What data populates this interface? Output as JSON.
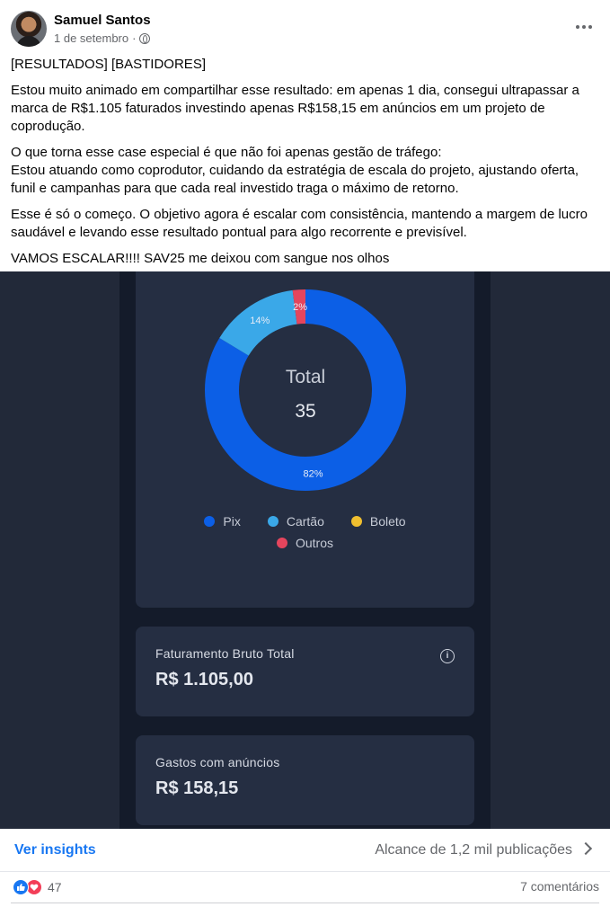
{
  "post": {
    "author": "Samuel Santos",
    "date": "1 de setembro",
    "separator": "·",
    "privacy_icon": "globe-icon",
    "more_icon": "more-horizontal-icon",
    "paragraphs": [
      "[RESULTADOS] [BASTIDORES]",
      "Estou muito animado em compartilhar esse resultado: em apenas 1 dia, consegui ultrapassar a marca de R$1.105 faturados investindo apenas R$158,15 em anúncios em um projeto de coprodução.",
      "O que torna esse case especial é que não foi apenas gestão de tráfego:\nEstou atuando como coprodutor, cuidando da estratégia de escala do projeto, ajustando oferta, funil e campanhas para que cada real investido traga o máximo de retorno.",
      "Esse é só o começo. O objetivo agora é escalar com consistência, mantendo a margem de lucro saudável e levando esse resultado pontual para algo recorrente e previsível.",
      "VAMOS ESCALAR!!!! SAV25 me deixou com sangue nos olhos"
    ]
  },
  "image": {
    "donut": {
      "center_title": "Total",
      "center_value": "35"
    },
    "faturamento": {
      "label": "Faturamento Bruto Total",
      "value": "R$ 1.105,00",
      "icon": "info-icon"
    },
    "gastos": {
      "label": "Gastos com anúncios",
      "value": "R$ 158,15"
    }
  },
  "chart_data": {
    "type": "pie",
    "variant": "donut",
    "categories": [
      "Pix",
      "Cartão",
      "Boleto",
      "Outros"
    ],
    "values": [
      82,
      14,
      0,
      2
    ],
    "unit": "%",
    "colors": [
      "#0c5fe6",
      "#3aa8e8",
      "#f0bf2f",
      "#e5455d"
    ],
    "slice_labels": [
      "82%",
      "14%",
      "",
      "2%"
    ],
    "total_label": "Total",
    "total_value": 35,
    "legend_placement": "bottom"
  },
  "footer": {
    "insights_label": "Ver insights",
    "reach_label": "Alcance de 1,2 mil publicações",
    "reaction_count": "47",
    "comments_label": "7 comentários"
  }
}
